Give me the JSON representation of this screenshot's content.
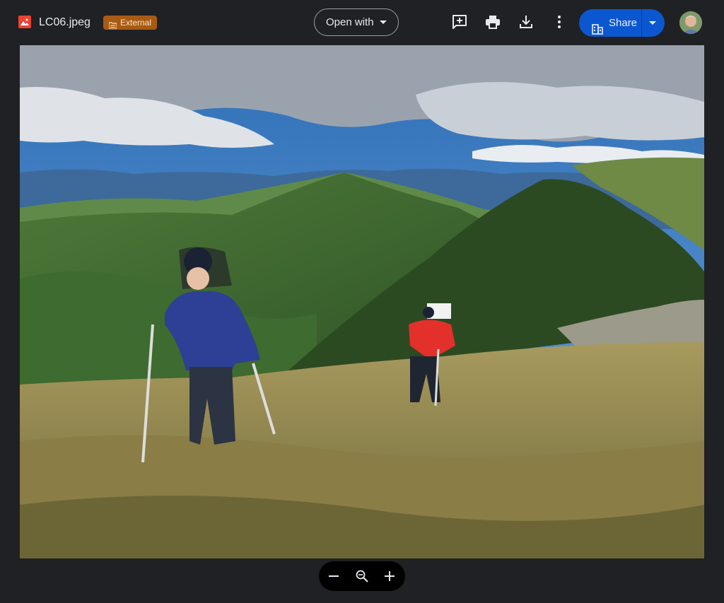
{
  "file": {
    "name": "LC06.jpeg",
    "badge": "External"
  },
  "toolbar": {
    "open_with_label": "Open with",
    "share_label": "Share",
    "icons": [
      "add-comment-icon",
      "print-icon",
      "download-icon",
      "more-vert-icon"
    ]
  },
  "zoom": {
    "icons": [
      "zoom-out-icon",
      "zoom-magnifier-icon",
      "zoom-in-icon"
    ]
  },
  "colors": {
    "background": "#202124",
    "share": "#0b57d0",
    "badge": "#a85b14",
    "file_icon": "#ea4335"
  }
}
